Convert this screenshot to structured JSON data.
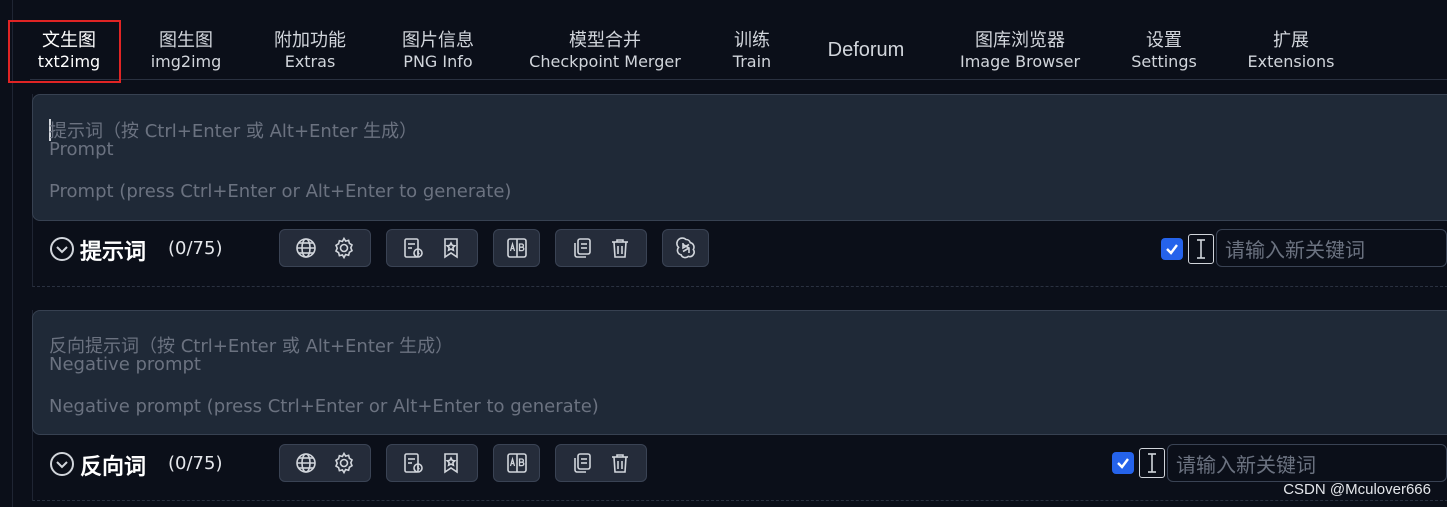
{
  "tabs": [
    {
      "cn": "文生图",
      "en": "txt2img",
      "active": true
    },
    {
      "cn": "图生图",
      "en": "img2img"
    },
    {
      "cn": "附加功能",
      "en": "Extras"
    },
    {
      "cn": "图片信息",
      "en": "PNG Info"
    },
    {
      "cn": "模型合并",
      "en": "Checkpoint Merger"
    },
    {
      "cn": "训练",
      "en": "Train"
    },
    {
      "cn": "Deforum",
      "en": ""
    },
    {
      "cn": "图库浏览器",
      "en": "Image Browser"
    },
    {
      "cn": "设置",
      "en": "Settings"
    },
    {
      "cn": "扩展",
      "en": "Extensions"
    }
  ],
  "prompt": {
    "placeholder_cn": "提示词（按 Ctrl+Enter 或 Alt+Enter 生成）",
    "placeholder_en": "Prompt",
    "placeholder_hint": "Prompt (press Ctrl+Enter or Alt+Enter to generate)",
    "label": "提示词",
    "count": "(0/75)",
    "keyword_placeholder": "请输入新关键词",
    "keyword_checked": true
  },
  "negative": {
    "placeholder_cn": "反向提示词（按 Ctrl+Enter 或 Alt+Enter 生成）",
    "placeholder_en": "Negative prompt",
    "placeholder_hint": "Negative prompt (press Ctrl+Enter or Alt+Enter to generate)",
    "label": "反向词",
    "count": "(0/75)",
    "keyword_placeholder": "请输入新关键词",
    "keyword_checked": true
  },
  "toolbar_icons": {
    "group1": [
      "globe-icon",
      "gear-icon"
    ],
    "group2": [
      "history-list-icon",
      "bookmark-star-icon"
    ],
    "group3": [
      "ab-translate-icon"
    ],
    "group4": [
      "copy-icon",
      "trash-icon"
    ],
    "group5": [
      "openai-icon"
    ]
  },
  "watermark": "CSDN @Mculover666",
  "colors": {
    "background": "#0b0f19",
    "textarea": "#1f2937",
    "accent": "#2563eb",
    "highlight_border": "#e02424"
  }
}
